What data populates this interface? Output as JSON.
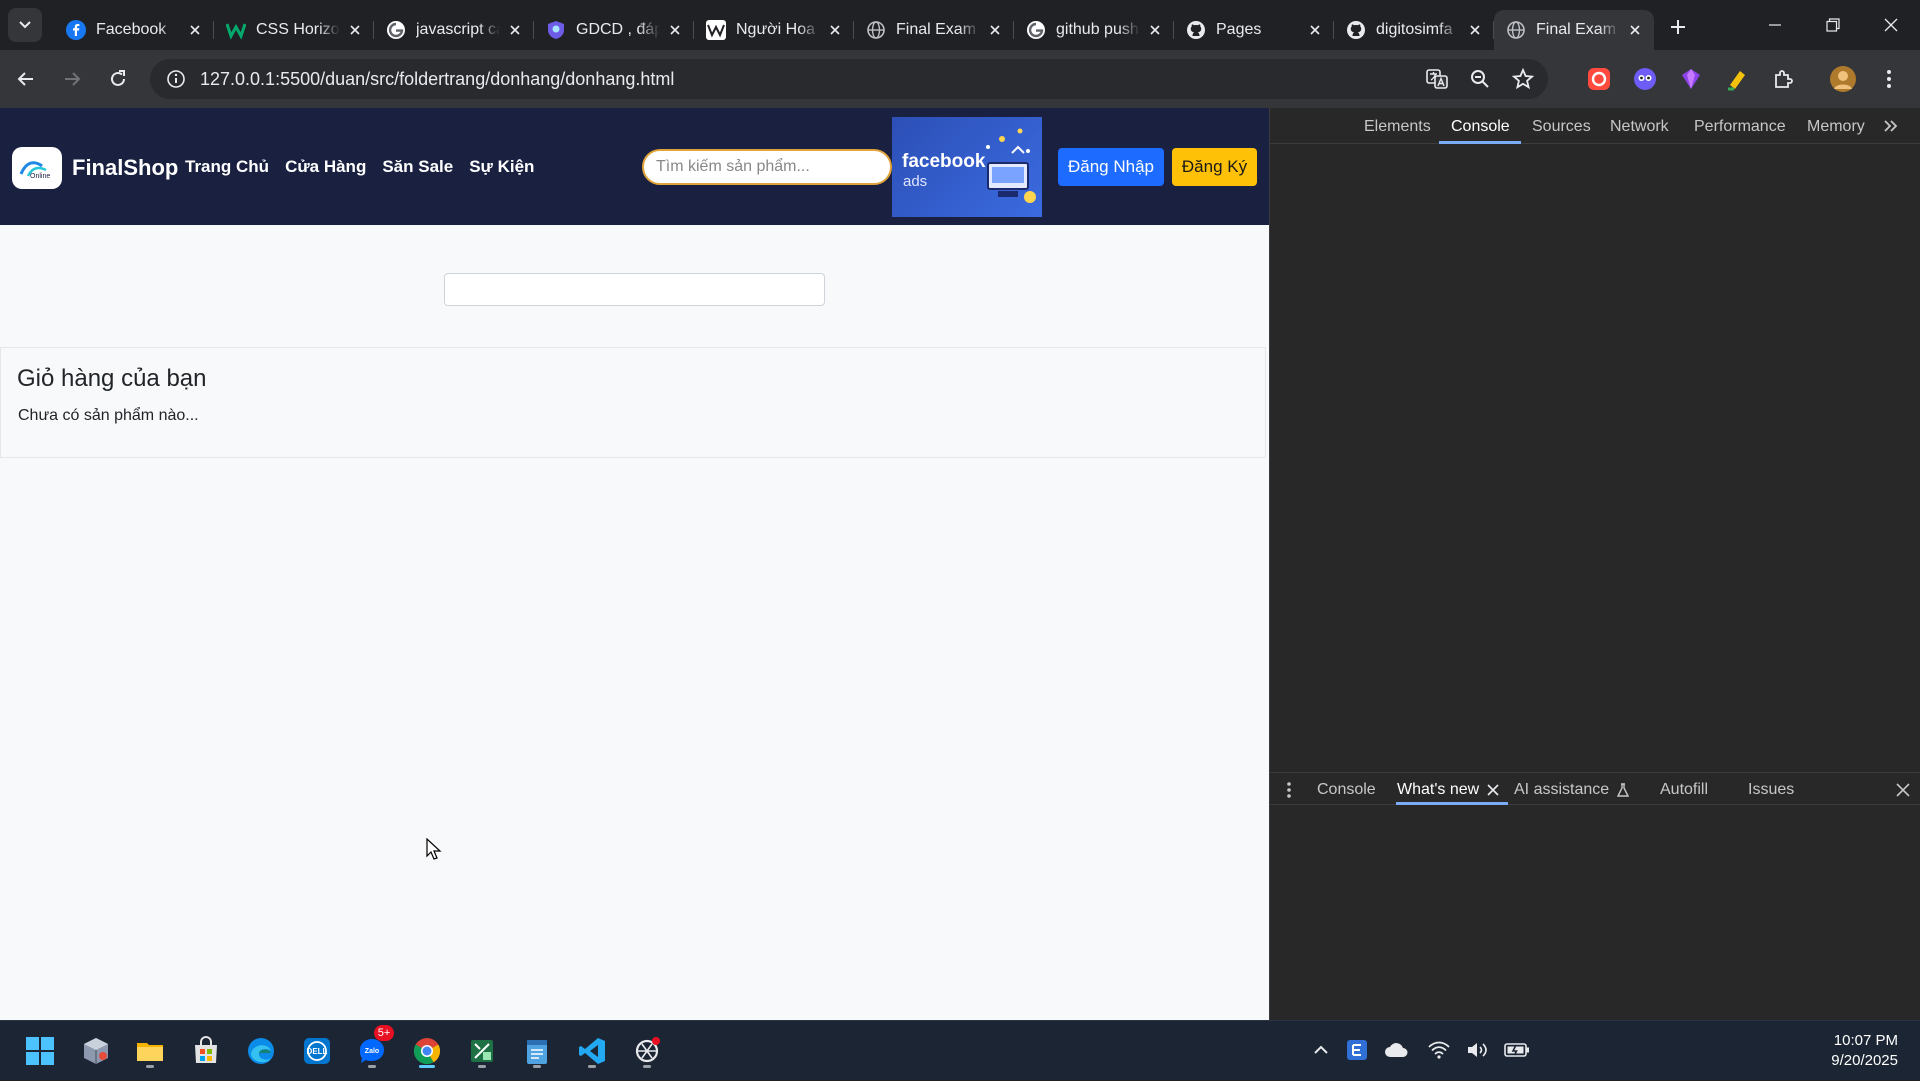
{
  "browser": {
    "tabs": [
      {
        "title": "Facebook",
        "icon": "facebook-icon"
      },
      {
        "title": "CSS Horizontal",
        "icon": "w3schools-icon"
      },
      {
        "title": "javascript cách",
        "icon": "google-icon"
      },
      {
        "title": "GDCD , đáp",
        "icon": "shield-logo-icon"
      },
      {
        "title": "Người Hoa",
        "icon": "wikipedia-icon"
      },
      {
        "title": "Final Exam",
        "icon": "globe-icon"
      },
      {
        "title": "github push",
        "icon": "google-icon"
      },
      {
        "title": "Pages",
        "icon": "github-icon"
      },
      {
        "title": "digitosimfa",
        "icon": "github-icon"
      },
      {
        "title": "Final Exam",
        "icon": "globe-icon",
        "active": true
      }
    ],
    "url": "127.0.0.1:5500/duan/src/foldertrang/donhang/donhang.html"
  },
  "site": {
    "logo_text": "FinalShop",
    "logo_mark": "Online",
    "nav": [
      "Trang Chủ",
      "Cửa Hàng",
      "Săn Sale",
      "Sự Kiện"
    ],
    "search_placeholder": "Tìm kiếm sản phẩm...",
    "ad": {
      "brand": "facebook",
      "sub": "ads"
    },
    "login_label": "Đăng Nhập",
    "register_label": "Đăng Ký"
  },
  "cart": {
    "title": "Giỏ hàng của bạn",
    "empty_message": "Chưa có sản phẩm nào..."
  },
  "devtools": {
    "tabs": [
      "Elements",
      "Console",
      "Sources",
      "Network",
      "Performance",
      "Memory"
    ],
    "active_tab": "Console",
    "drawer_tabs": [
      "Console",
      "What's new",
      "AI assistance",
      "Autofill",
      "Issues"
    ],
    "active_drawer_tab": "What's new"
  },
  "taskbar": {
    "icons": [
      "windows-start-icon",
      "package-icon",
      "file-explorer-icon",
      "microsoft-store-icon",
      "edge-icon",
      "dell-icon",
      "zalo-icon",
      "chrome-icon",
      "spreadsheet-icon",
      "notepad-icon",
      "vscode-icon",
      "openai-icon"
    ],
    "zalo_badge": "5+",
    "time": "10:07 PM",
    "date": "9/20/2025"
  },
  "colors": {
    "site_header": "#1a2040",
    "login_button": "#1e6cff",
    "register_button": "#ffc107",
    "devtools_accent": "#7cacf8"
  }
}
